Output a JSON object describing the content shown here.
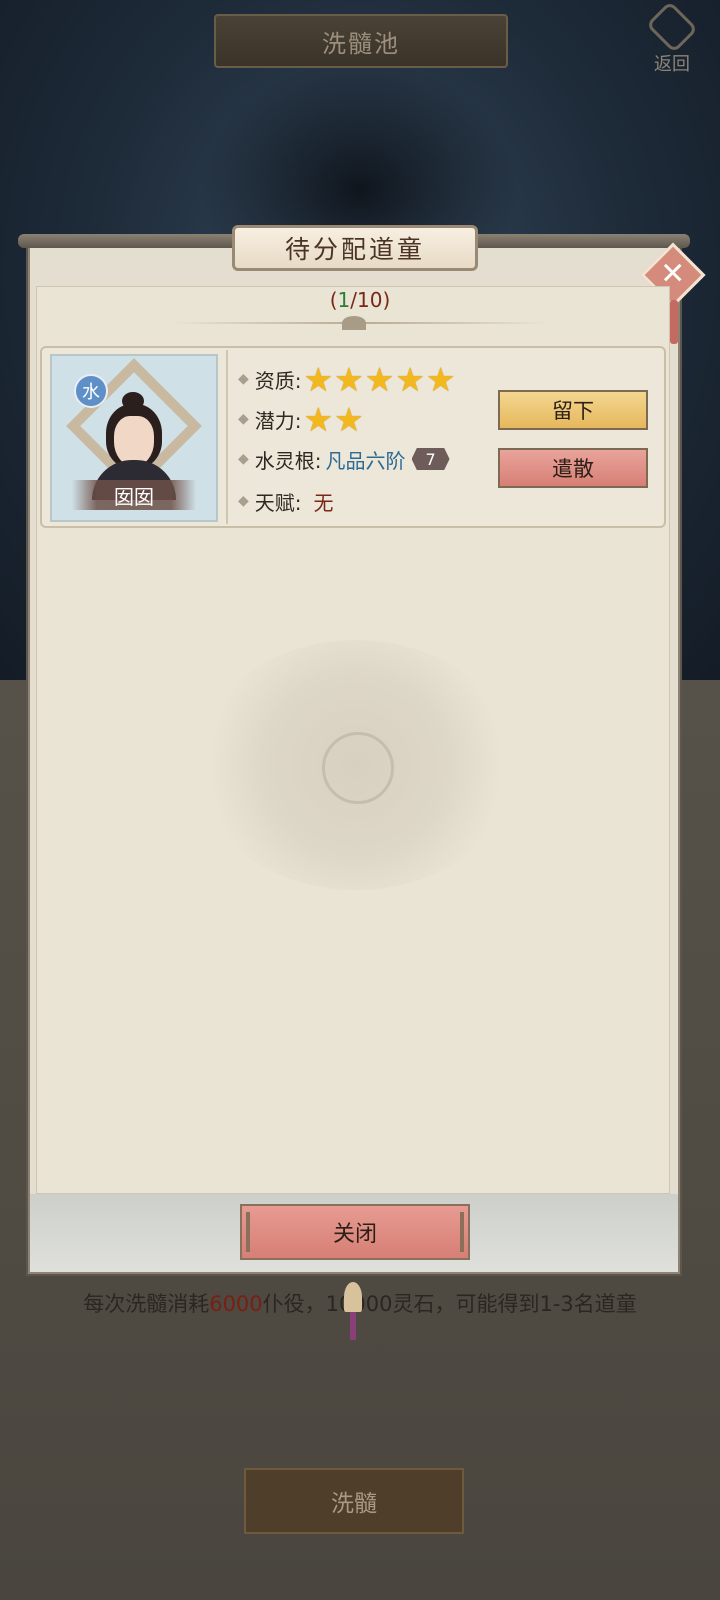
{
  "screen": {
    "title": "洗髓池",
    "back_label": "返回",
    "cost_text_prefix": "每次洗髓消耗",
    "cost_servants": "6000",
    "cost_text_mid": "仆役，",
    "cost_stones": "10000",
    "cost_text_suffix": "灵石，可能得到1-3名道童",
    "refine_button": "洗髓"
  },
  "modal": {
    "title": "待分配道童",
    "counter": {
      "open": "(",
      "current": "1",
      "sep": "/",
      "total": "10",
      "close": ")"
    },
    "close_button": "关闭",
    "close_icon": "close-icon"
  },
  "disciple": {
    "name": "囡囡",
    "element_badge": "水",
    "aptitude_label": "资质:",
    "aptitude_stars": 5,
    "potential_label": "潜力:",
    "potential_stars": 2,
    "root_label": "水灵根:",
    "root_value": "凡品六阶",
    "root_grade": "7",
    "talent_label": "天赋:",
    "talent_value": "无",
    "keep_button": "留下",
    "dismiss_button": "遣散"
  },
  "colors": {
    "star": "#f2b81e",
    "keep_button": "#e6b85c",
    "dismiss_button": "#d77f76",
    "root_value": "#2e6b94",
    "counter_current": "#2e7d32",
    "talent_value": "#7a2718"
  }
}
